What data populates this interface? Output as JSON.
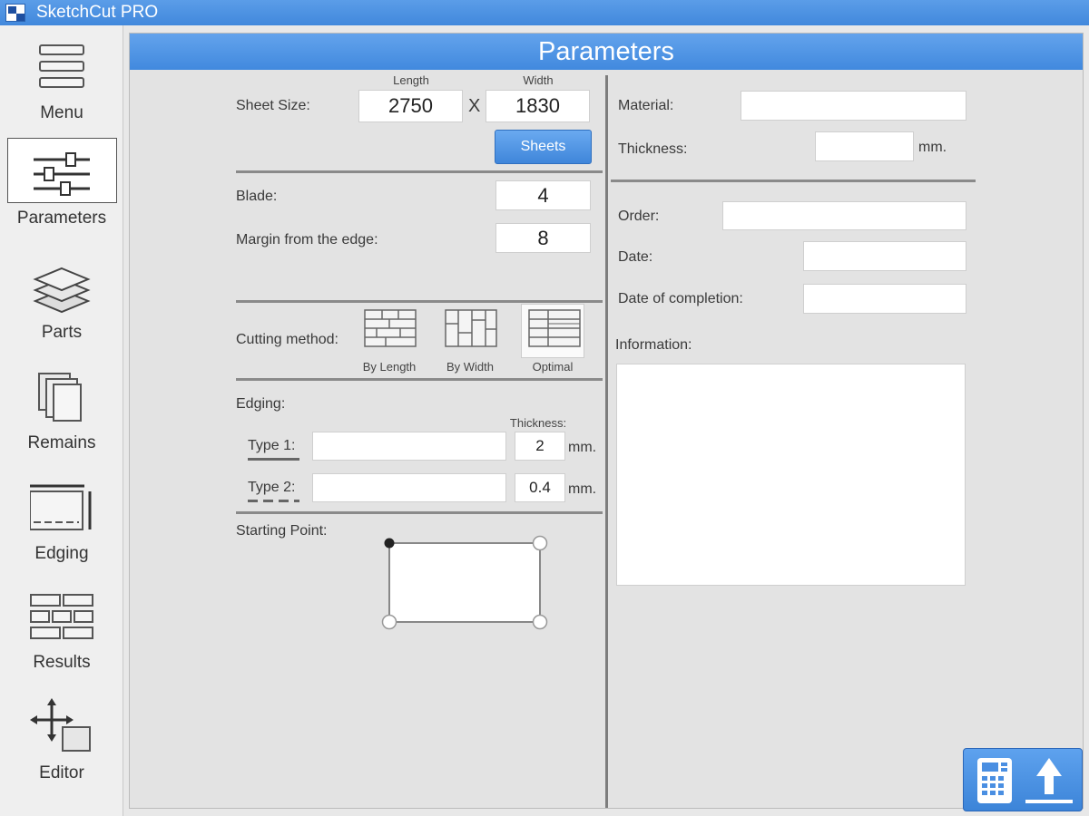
{
  "window": {
    "title": "SketchCut PRO"
  },
  "sidebar": {
    "items": [
      {
        "label": "Menu",
        "icon": "menu-icon"
      },
      {
        "label": "Parameters",
        "icon": "sliders-icon"
      },
      {
        "label": "Parts",
        "icon": "layers-icon"
      },
      {
        "label": "Remains",
        "icon": "pages-icon"
      },
      {
        "label": "Edging",
        "icon": "edging-icon"
      },
      {
        "label": "Results",
        "icon": "grid-icon"
      },
      {
        "label": "Editor",
        "icon": "move-icon"
      }
    ],
    "active": "Parameters"
  },
  "panel": {
    "title": "Parameters"
  },
  "sheet": {
    "label": "Sheet Size:",
    "length_header": "Length",
    "width_header": "Width",
    "length": "2750",
    "separator": "X",
    "width": "1830",
    "sheets_button": "Sheets"
  },
  "blade": {
    "label": "Blade:",
    "value": "4"
  },
  "margin": {
    "label": "Margin from the edge:",
    "value": "8"
  },
  "cutting": {
    "label": "Cutting method:",
    "options": [
      {
        "label": "By Length"
      },
      {
        "label": "By Width"
      },
      {
        "label": "Optimal"
      }
    ],
    "selected": "Optimal"
  },
  "edging": {
    "label": "Edging:",
    "thickness_header": "Thickness:",
    "type1": {
      "label": "Type 1:",
      "name": "",
      "thickness": "2",
      "unit": "mm."
    },
    "type2": {
      "label": "Type 2:",
      "name": "",
      "thickness": "0.4",
      "unit": "mm."
    }
  },
  "starting_point": {
    "label": "Starting Point:"
  },
  "material": {
    "label": "Material:",
    "value": ""
  },
  "thickness": {
    "label": "Thickness:",
    "value": "",
    "unit": "mm."
  },
  "order": {
    "label": "Order:",
    "value": ""
  },
  "date": {
    "label": "Date:",
    "value": ""
  },
  "date_completion": {
    "label": "Date of completion:",
    "value": ""
  },
  "information": {
    "label": "Information:",
    "value": ""
  },
  "actions": {
    "icons": [
      "calculator-icon",
      "upload-icon"
    ]
  },
  "colors": {
    "accent": "#4a8fe2",
    "panel_bg": "#e3e3e3",
    "sidebar_bg": "#efefef"
  }
}
